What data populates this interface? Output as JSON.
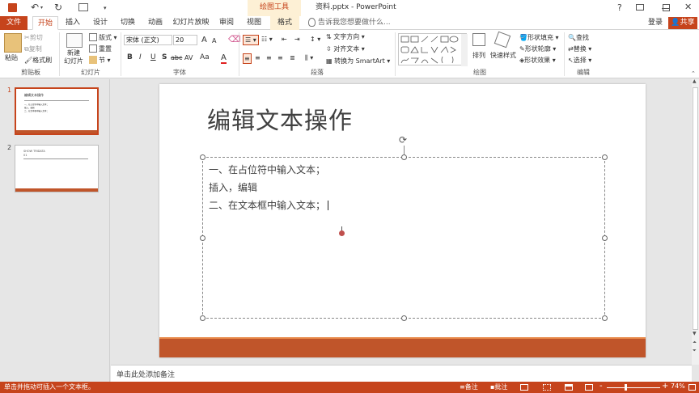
{
  "window": {
    "title": "资料.pptx - PowerPoint",
    "context_tab_group": "绘图工具",
    "controls": {
      "help": "?",
      "restore": "",
      "minimize": "",
      "maximize": "",
      "close": "✕"
    }
  },
  "qat": {
    "undo_count": "",
    "redo": "",
    "slide_from": ""
  },
  "tabs": {
    "file": "文件",
    "home": "开始",
    "insert": "插入",
    "design": "设计",
    "transitions": "切换",
    "animations": "动画",
    "slideshow": "幻灯片放映",
    "review": "审阅",
    "view": "视图",
    "format": "格式",
    "tellme": "告诉我您想要做什么...",
    "signin": "登录",
    "share": "共享"
  },
  "ribbon": {
    "clipboard": {
      "label": "剪贴板",
      "paste": "粘贴",
      "cut": "剪切",
      "copy": "复制",
      "format_painter": "格式刷"
    },
    "slides": {
      "label": "幻灯片",
      "new_slide": "新建\n幻灯片",
      "layout": "版式",
      "reset": "重置",
      "section": "节"
    },
    "font": {
      "label": "字体",
      "font_name": "宋体 (正文)",
      "font_size": "20",
      "bold": "B",
      "italic": "I",
      "underline": "U",
      "shadow": "S",
      "strike": "abc",
      "spacing": "AV",
      "case": "Aa",
      "color": "A",
      "grow": "A",
      "shrink": "A"
    },
    "paragraph": {
      "label": "段落",
      "text_direction": "文字方向",
      "align_text": "对齐文本",
      "smartart": "转换为 SmartArt"
    },
    "drawing": {
      "label": "绘图",
      "arrange": "排列",
      "quick_styles": "快速样式",
      "fill": "形状填充",
      "outline": "形状轮廓",
      "effects": "形状效果"
    },
    "editing": {
      "label": "编辑",
      "find": "查找",
      "replace": "替换",
      "select": "选择"
    }
  },
  "slides": [
    {
      "number": "1",
      "title": "编辑文本操作",
      "lines": [
        "一、在占位符中输入文本；",
        "插入，编辑",
        "二、在文本框中输入文本；"
      ]
    },
    {
      "number": "2",
      "title": "SHOW TRIDATA",
      "lines": [
        "01"
      ]
    }
  ],
  "current_slide": {
    "title": "编辑文本操作",
    "body": [
      "一、在占位符中输入文本；",
      "插入，编辑",
      "二、在文本框中输入文本；"
    ],
    "accent_color": "#c0552a"
  },
  "notes": {
    "placeholder": "单击此处添加备注"
  },
  "status": {
    "message": "单击并拖动可插入一个文本框。",
    "notes_btn": "备注",
    "comments_btn": "批注",
    "zoom": "74%",
    "zoom_minus": "-",
    "zoom_plus": "+"
  },
  "colors": {
    "accent": "#c6441c",
    "tab_active": "#c6441c",
    "context_tab": "#fdf0d5"
  }
}
